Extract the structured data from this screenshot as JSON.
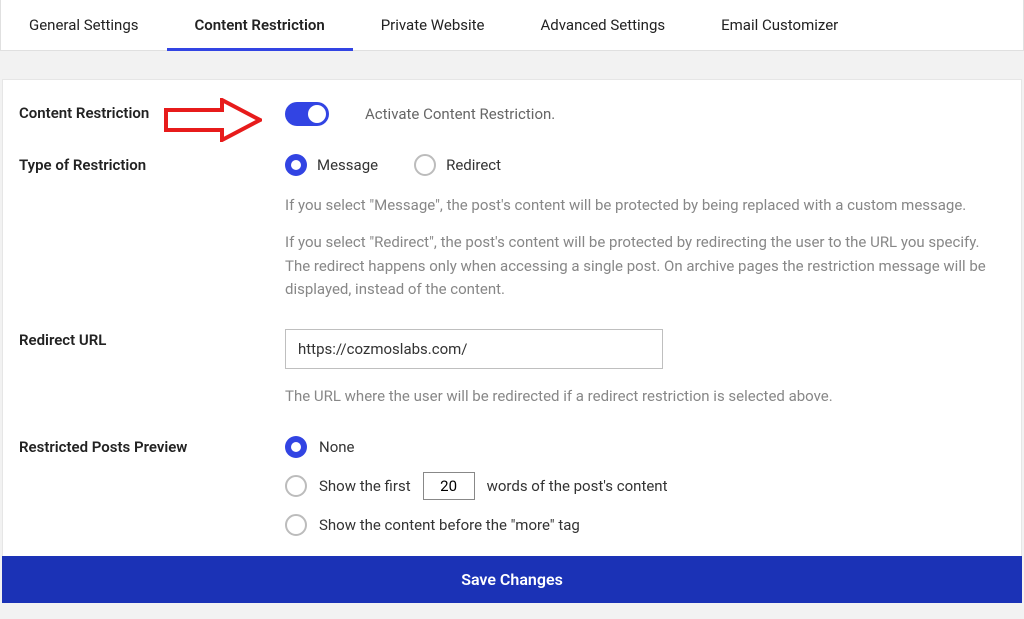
{
  "tabs": [
    {
      "label": "General Settings"
    },
    {
      "label": "Content Restriction"
    },
    {
      "label": "Private Website"
    },
    {
      "label": "Advanced Settings"
    },
    {
      "label": "Email Customizer"
    }
  ],
  "section1": {
    "title": "Content Restriction",
    "toggle_desc": "Activate Content Restriction."
  },
  "section2": {
    "title": "Type of Restriction",
    "opt_message": "Message",
    "opt_redirect": "Redirect",
    "help1": "If you select \"Message\", the post's content will be protected by being replaced with a custom message.",
    "help2": "If you select \"Redirect\", the post's content will be protected by redirecting the user to the URL you specify. The redirect happens only when accessing a single post. On archive pages the restriction message will be displayed, instead of the content."
  },
  "section3": {
    "title": "Redirect URL",
    "url_value": "https://cozmoslabs.com/",
    "help": "The URL where the user will be redirected if a redirect restriction is selected above."
  },
  "section4": {
    "title": "Restricted Posts Preview",
    "opt_none": "None",
    "opt_first_pre": "Show the first",
    "opt_first_val": "20",
    "opt_first_post": "words of the post's content",
    "opt_more": "Show the content before the \"more\" tag"
  },
  "save_label": "Save Changes"
}
